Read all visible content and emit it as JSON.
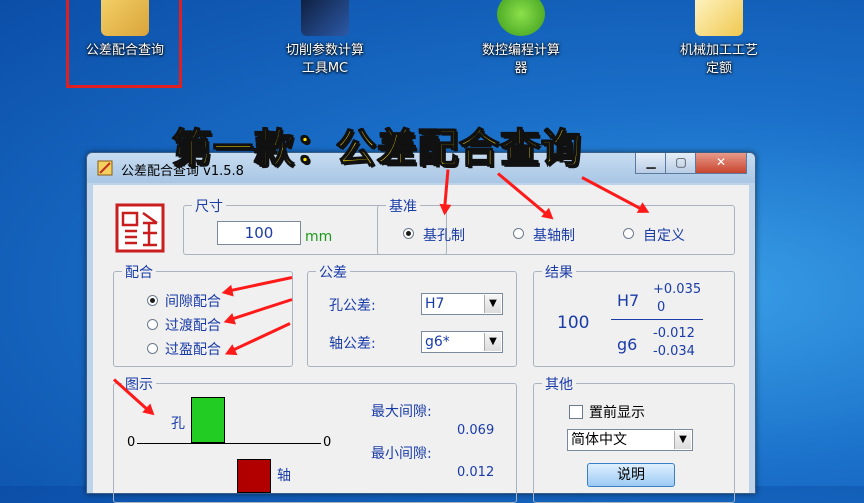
{
  "desktop": {
    "icons": [
      {
        "label": "公差配合查询"
      },
      {
        "label_line1": "切削参数计算",
        "label_line2": "工具MC"
      },
      {
        "label_line1": "数控编程计算",
        "label_line2": "器"
      },
      {
        "label_line1": "机械加工工艺",
        "label_line2": "定额"
      }
    ]
  },
  "banner": {
    "text": "第一款：公差配合查询"
  },
  "window": {
    "title": "公差配合查询  v1.5.8",
    "controls": {
      "minimize": "▁",
      "maximize": "▢",
      "close": "✕"
    },
    "size_group": {
      "label": "尺寸",
      "value": "100",
      "unit": "mm"
    },
    "basis_group": {
      "label": "基准",
      "options": [
        "基孔制",
        "基轴制",
        "自定义"
      ],
      "selected": 0
    },
    "fit_group": {
      "label": "配合",
      "options": [
        "间隙配合",
        "过渡配合",
        "过盈配合"
      ],
      "selected": 0
    },
    "tolerance_group": {
      "label": "公差",
      "hole_label": "孔公差:",
      "hole_value": "H7",
      "shaft_label": "轴公差:",
      "shaft_value": "g6*"
    },
    "result_group": {
      "label": "结果",
      "size": "100",
      "hole": "H7",
      "hole_upper": "+0.035",
      "hole_lower": "0",
      "shaft": "g6",
      "shaft_upper": "-0.012",
      "shaft_lower": "-0.034"
    },
    "diagram_group": {
      "label": "图示",
      "hole_label": "孔",
      "shaft_label": "轴",
      "zero_left": "0",
      "zero_right": "0",
      "max_label": "最大间隙:",
      "max_value": "0.069",
      "min_label": "最小间隙:",
      "min_value": "0.012"
    },
    "other_group": {
      "label": "其他",
      "topmost_label": "置前显示",
      "topmost_checked": false,
      "language": "简体中文",
      "help_button": "说明"
    }
  },
  "colors": {
    "label_blue": "#1a3ca8",
    "hole_fill": "#22cc22",
    "shaft_fill": "#b00000",
    "arrow": "#ff1a1a",
    "banner": "#ffe600"
  }
}
